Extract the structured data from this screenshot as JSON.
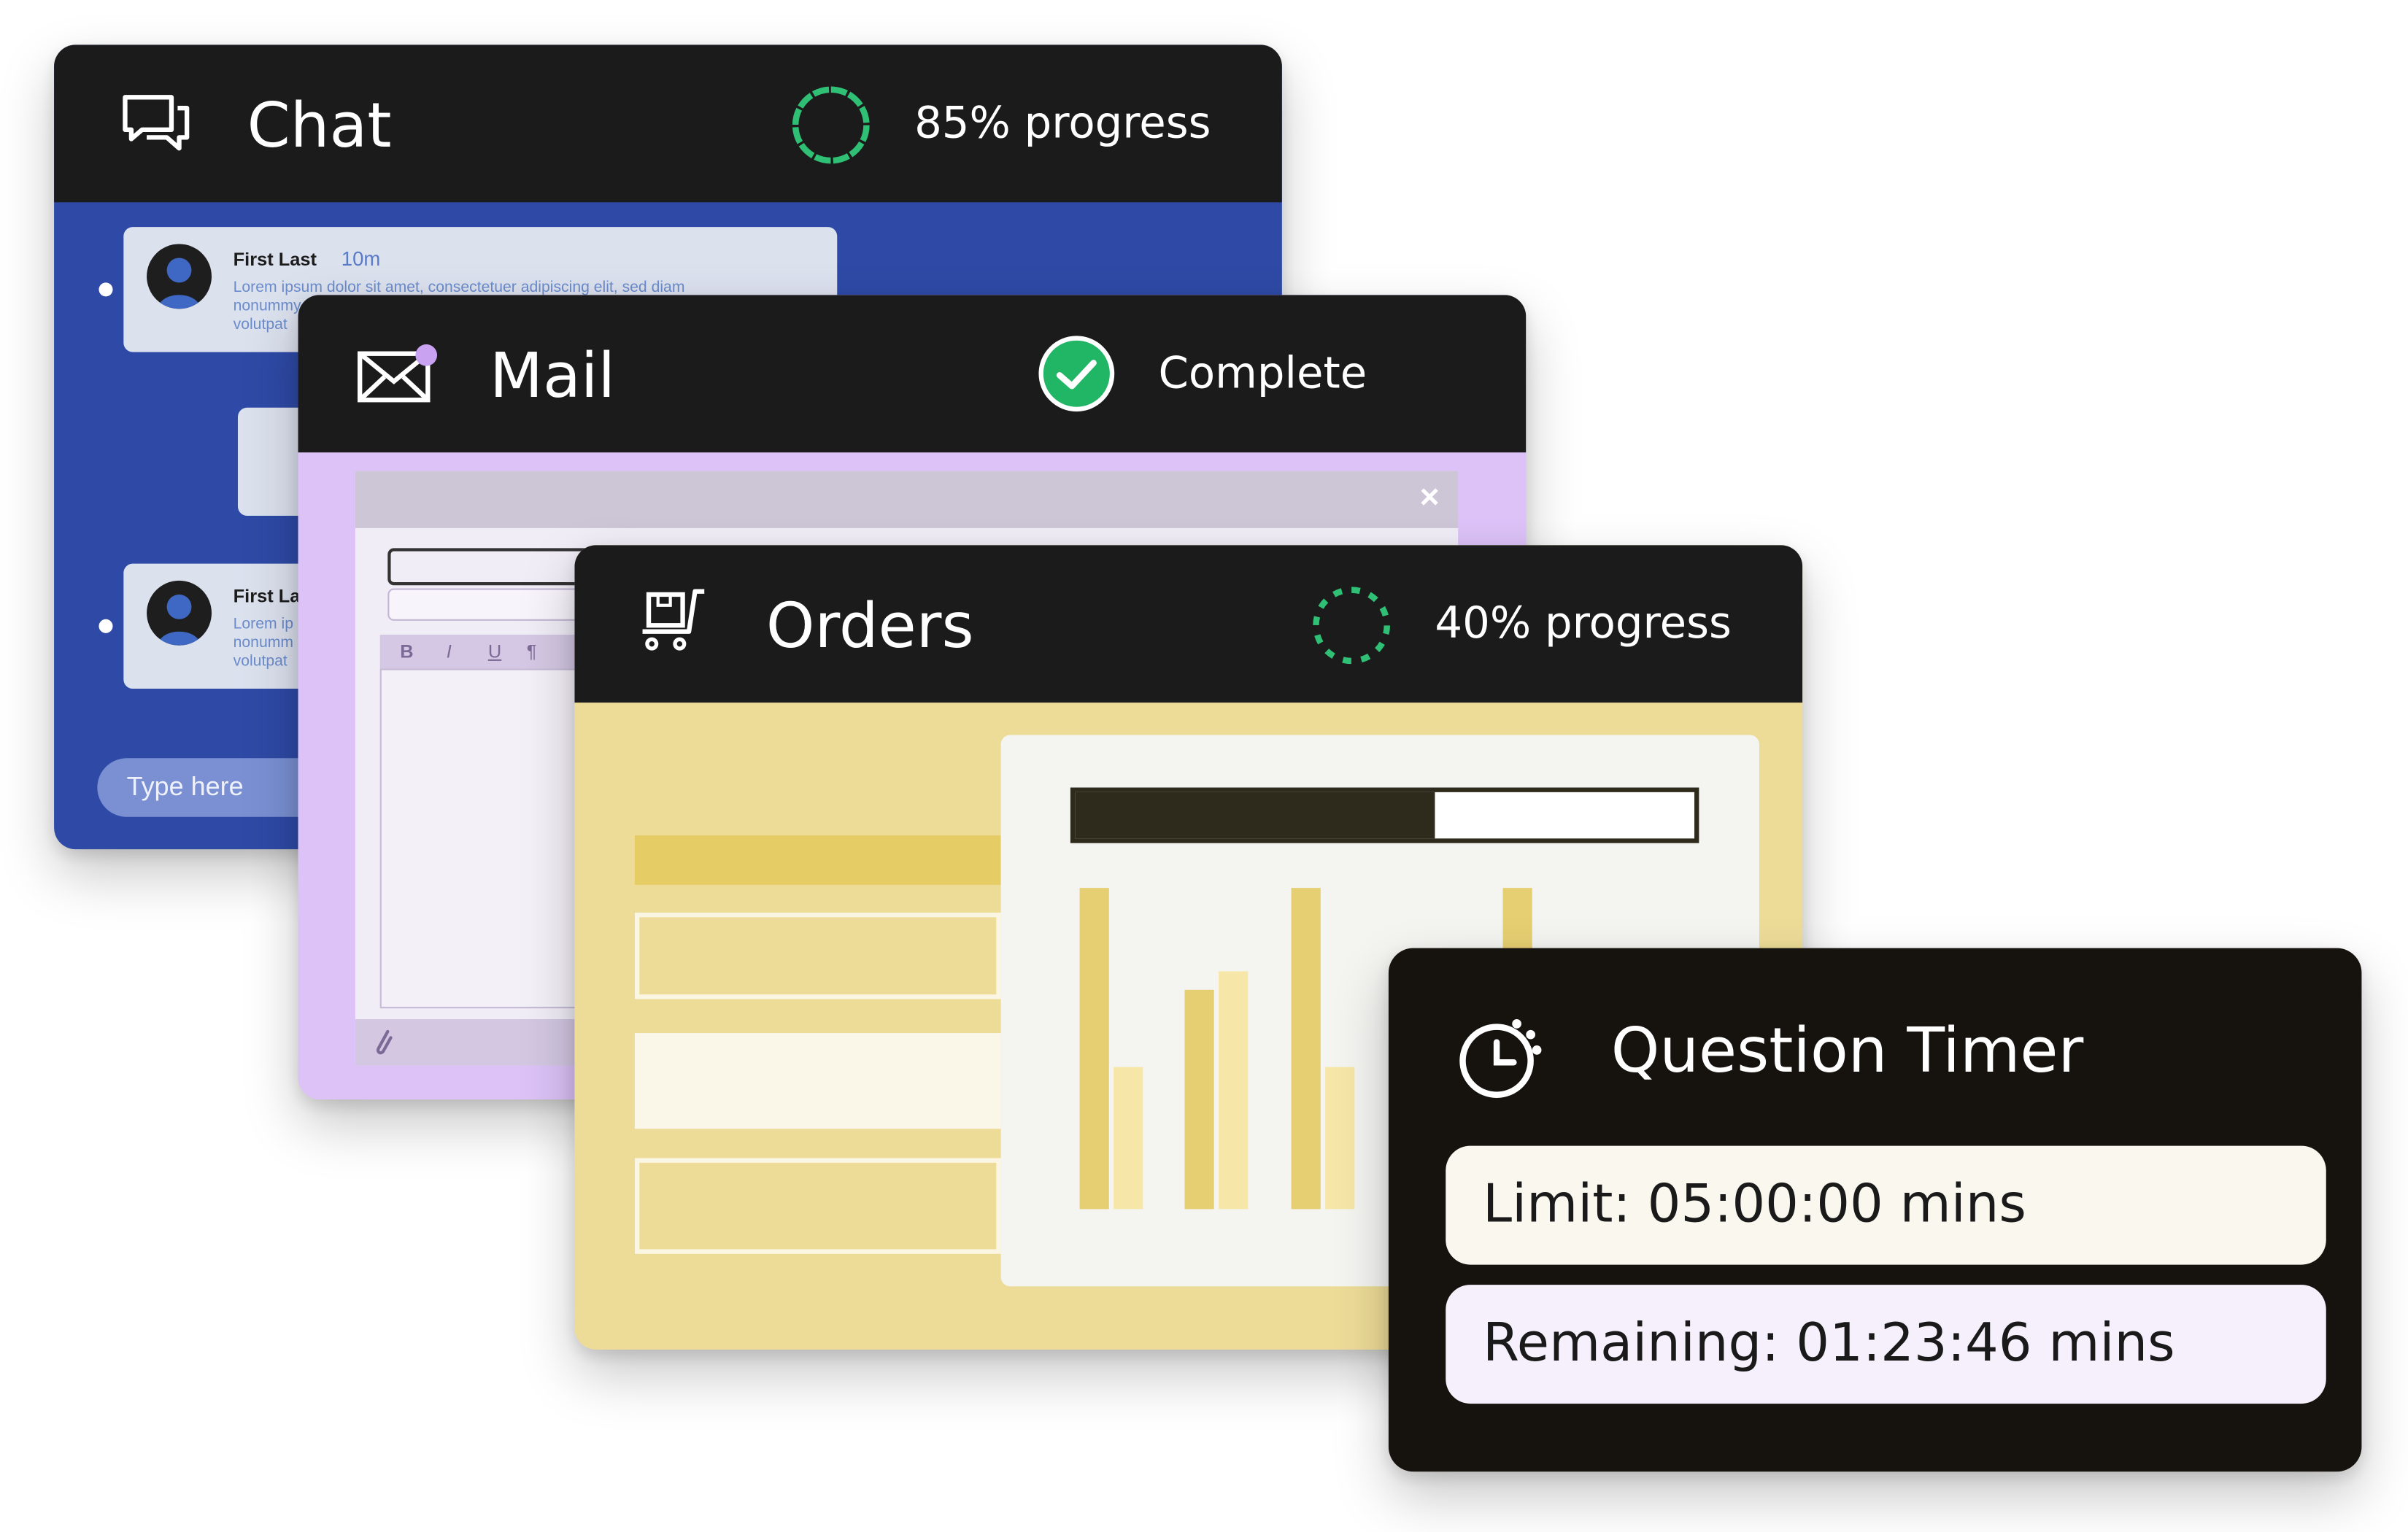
{
  "chat": {
    "title": "Chat",
    "status": "85% progress",
    "progress_pct": 85,
    "messages": [
      {
        "name": "First Last",
        "time": "10m",
        "lines": [
          "Lorem ipsum dolor sit amet, consectetuer adipiscing elit, sed diam",
          "nonummy",
          "volutpat"
        ]
      },
      {
        "name": "First La",
        "lines": [
          "Lorem ip",
          "nonumm",
          "volutpat"
        ]
      }
    ],
    "input_placeholder": "Type here",
    "color": "#2e4aa6"
  },
  "mail": {
    "title": "Mail",
    "status": "Complete",
    "toolbar": [
      "B",
      "I",
      "U",
      "¶"
    ],
    "close_glyph": "×",
    "color": "#dcc2f7"
  },
  "orders": {
    "title": "Orders",
    "status": "40% progress",
    "progress_pct": 40,
    "bar_progress_pct": 58,
    "color": "#eddc98"
  },
  "timer": {
    "title": "Question Timer",
    "limit": "Limit: 05:00:00 mins",
    "remaining": "Remaining: 01:23:46 mins"
  },
  "accents": {
    "ring": "#2fbf75",
    "check_bg": "#21b566",
    "header": "#1b1b1b"
  }
}
